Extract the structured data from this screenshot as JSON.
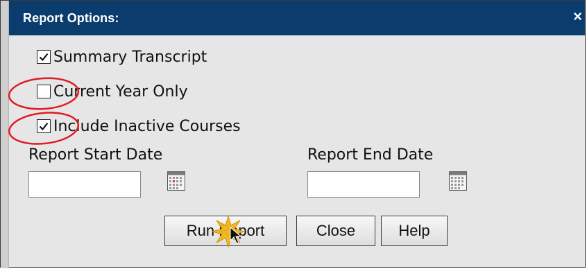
{
  "dialog": {
    "title": "Report Options:",
    "close_label": "×"
  },
  "options": [
    {
      "label": "Summary Transcript",
      "checked": true
    },
    {
      "label": "Current Year Only",
      "checked": false
    },
    {
      "label": "Include Inactive Courses",
      "checked": true
    }
  ],
  "dates": {
    "start_label": "Report Start Date",
    "end_label": "Report End Date",
    "start_value": "",
    "end_value": ""
  },
  "buttons": {
    "run_report": "Run Report",
    "close": "Close",
    "help": "Help"
  },
  "icons": {
    "calendar": "calendar-icon",
    "checkmark": "checkmark-icon",
    "cursor": "mouse-pointer-icon",
    "click": "click-burst-icon",
    "highlight": "red-ellipse-annotation"
  },
  "colors": {
    "titlebar": "#0b3c6e",
    "panel": "#e6e6e6",
    "annotation": "#e01b24"
  }
}
